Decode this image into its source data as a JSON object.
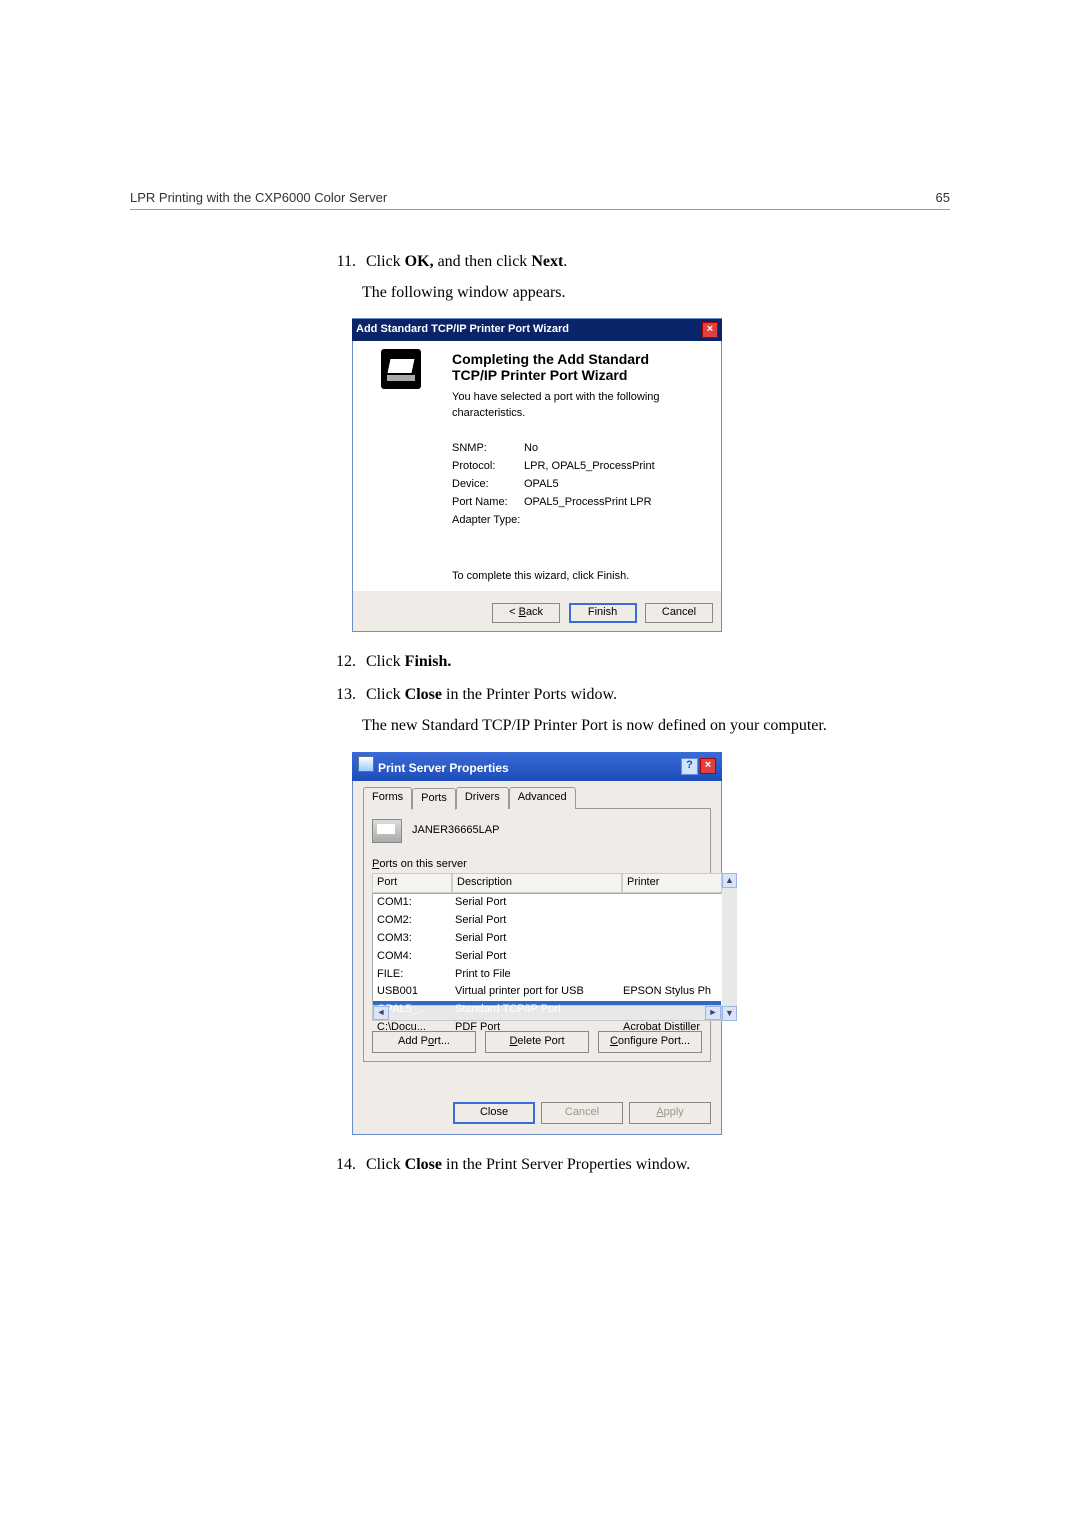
{
  "header": {
    "left": "LPR Printing with the CXP6000 Color Server",
    "right": "65"
  },
  "steps": {
    "s11": {
      "num": "11.",
      "t1": "Click ",
      "b1": "OK,",
      "t2": " and then click ",
      "b2": "Next",
      "t3": "."
    },
    "s11b": "The following window appears.",
    "s12": {
      "num": "12.",
      "t1": "Click ",
      "b1": "Finish."
    },
    "s13": {
      "num": "13.",
      "t1": "Click ",
      "b1": "Close",
      "t2": " in the Printer Ports widow."
    },
    "s13b": "The new Standard TCP/IP Printer Port is now defined on your computer.",
    "s14": {
      "num": "14.",
      "t1": "Click ",
      "b1": "Close",
      "t2": " in the Print Server Properties window."
    }
  },
  "wizard": {
    "title": "Add Standard TCP/IP Printer Port Wizard",
    "heading1": "Completing the Add Standard",
    "heading2": "TCP/IP Printer Port Wizard",
    "sub": "You have selected a port with the following characteristics.",
    "rows": {
      "r1": {
        "l": "SNMP:",
        "v": "No"
      },
      "r2": {
        "l": "Protocol:",
        "v": "LPR, OPAL5_ProcessPrint"
      },
      "r3": {
        "l": "Device:",
        "v": "OPAL5"
      },
      "r4": {
        "l": "Port Name:",
        "v": "OPAL5_ProcessPrint LPR"
      },
      "r5": {
        "l": "Adapter Type:",
        "v": ""
      }
    },
    "footer": "To complete this wizard, click Finish.",
    "btn_back_pre": "< ",
    "btn_back_u": "B",
    "btn_back_post": "ack",
    "btn_finish": "Finish",
    "btn_cancel": "Cancel"
  },
  "props": {
    "title": "Print Server Properties",
    "tabs": {
      "forms": "Forms",
      "ports": "Ports",
      "drivers": "Drivers",
      "advanced": "Advanced"
    },
    "server": "JANER36665LAP",
    "ports_label_pre": "",
    "ports_label_u": "P",
    "ports_label_post": "orts on this server",
    "cols": {
      "c1": "Port",
      "c2": "Description",
      "c3": "Printer"
    },
    "rows": [
      {
        "c1": "COM1:",
        "c2": "Serial Port",
        "c3": ""
      },
      {
        "c1": "COM2:",
        "c2": "Serial Port",
        "c3": ""
      },
      {
        "c1": "COM3:",
        "c2": "Serial Port",
        "c3": ""
      },
      {
        "c1": "COM4:",
        "c2": "Serial Port",
        "c3": ""
      },
      {
        "c1": "FILE:",
        "c2": "Print to File",
        "c3": ""
      },
      {
        "c1": "USB001",
        "c2": "Virtual printer port for USB",
        "c3": "EPSON Stylus Ph"
      },
      {
        "c1": "OPAL5_...",
        "c2": "Standard TCP/IP Port",
        "c3": ""
      },
      {
        "c1": "C:\\Docu...",
        "c2": "PDF Port",
        "c3": "Acrobat Distiller"
      }
    ],
    "btn_addport_pre": "Add P",
    "btn_addport_u": "o",
    "btn_addport_post": "rt...",
    "btn_delport_u": "D",
    "btn_delport_post": "elete Port",
    "btn_cfgport_u": "C",
    "btn_cfgport_post": "onfigure Port...",
    "btn_close": "Close",
    "btn_cancel": "Cancel",
    "btn_apply_u": "A",
    "btn_apply_post": "pply"
  }
}
